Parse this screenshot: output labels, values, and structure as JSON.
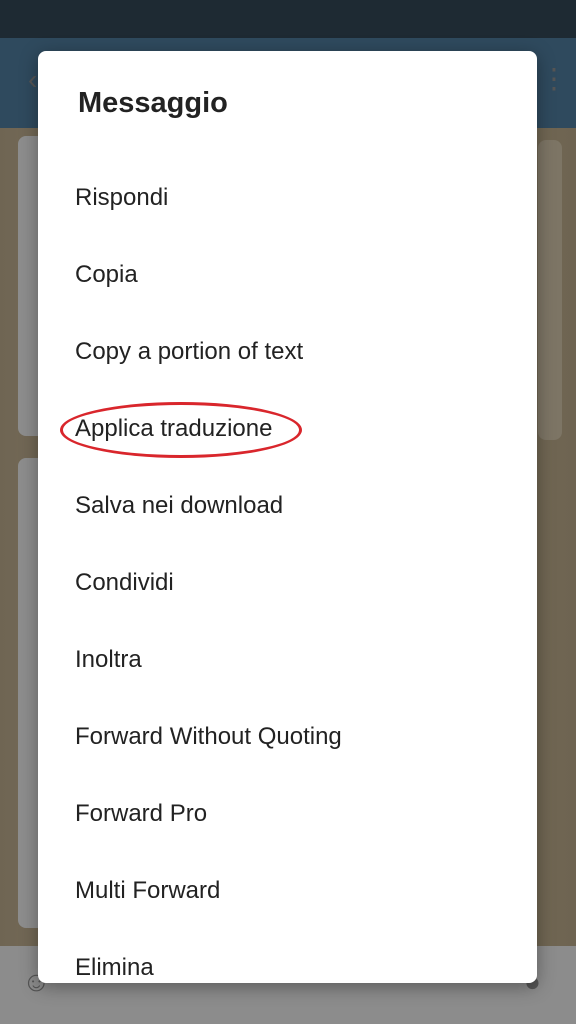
{
  "dialog": {
    "title": "Messaggio",
    "items": [
      {
        "label": "Rispondi"
      },
      {
        "label": "Copia"
      },
      {
        "label": "Copy a portion of text"
      },
      {
        "label": "Applica traduzione",
        "highlighted": true
      },
      {
        "label": "Salva nei download"
      },
      {
        "label": "Condividi"
      },
      {
        "label": "Inoltra"
      },
      {
        "label": "Forward Without Quoting"
      },
      {
        "label": "Forward Pro"
      },
      {
        "label": "Multi Forward"
      },
      {
        "label": "Elimina"
      }
    ]
  },
  "annotation": {
    "color": "#d9262c"
  }
}
